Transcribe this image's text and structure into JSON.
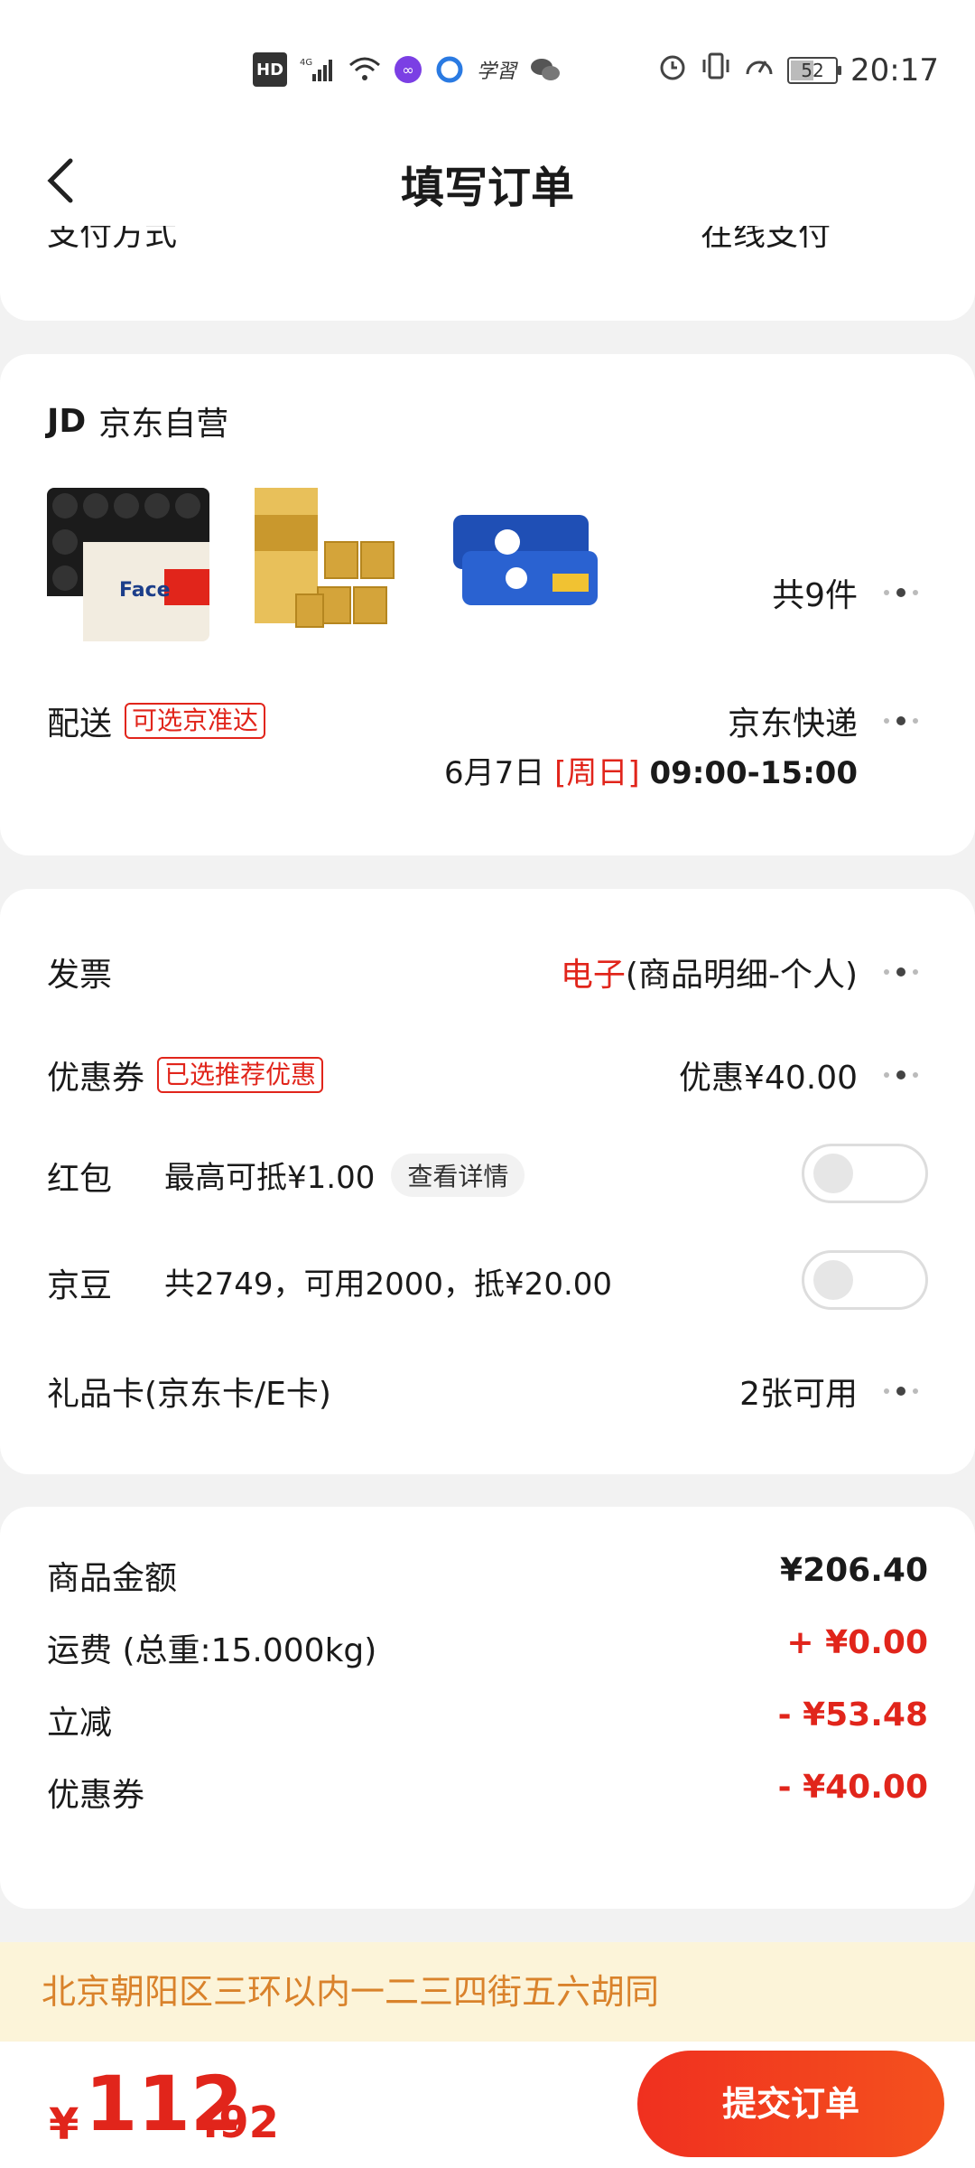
{
  "status_bar": {
    "network": "4G",
    "time": "20:17",
    "battery": "52",
    "battery_level": 0.52,
    "left_icons": [
      "hd-icon",
      "signal-icon",
      "wifi-icon",
      "app-icon",
      "browser-icon",
      "study-icon",
      "wechat-icon"
    ],
    "hd_label": "HD",
    "study_label": "学習"
  },
  "header": {
    "title": "填写订单"
  },
  "payment": {
    "label": "支付方式",
    "value": "在线支付"
  },
  "shop": {
    "name": "京东自营",
    "logo": "JD",
    "total_items": "共9件",
    "delivery_label": "配送",
    "delivery_tag": "可选京准达",
    "courier": "京东快递",
    "date": "6月7日",
    "weekday": "[周日]",
    "time_window": "09:00-15:00",
    "products": [
      "product-tissue-face",
      "product-tissue-qingfeng",
      "product-wet-wipes"
    ]
  },
  "benefits": {
    "invoice_label": "发票",
    "invoice_type": "电子",
    "invoice_detail": "(商品明细-个人)",
    "coupon_label": "优惠券",
    "coupon_tag": "已选推荐优惠",
    "coupon_value": "优惠¥40.00",
    "redpacket_label": "红包",
    "redpacket_desc": "最高可抵¥1.00",
    "redpacket_detail": "查看详情",
    "jingdou_label": "京豆",
    "jingdou_desc": "共2749，可用2000，抵¥20.00",
    "giftcard_label": "礼品卡(京东卡/E卡)",
    "giftcard_value": "2张可用"
  },
  "summary": {
    "goods_label": "商品金额",
    "goods_value": "¥206.40",
    "shipping_label": "运费 (总重:15.000kg)",
    "shipping_value": "+ ¥0.00",
    "discount_label": "立减",
    "discount_value": "- ¥53.48",
    "coupon_label": "优惠券",
    "coupon_value": "- ¥40.00"
  },
  "address": "北京朝阳区三环以内一二三四街五六胡同",
  "footer": {
    "currency": "¥",
    "price_int": "112",
    "price_dec": ".92",
    "submit_label": "提交订单"
  },
  "colors": {
    "accent": "#e1251b",
    "address_bg": "#fcf4d9",
    "address_text": "#d9822b"
  }
}
